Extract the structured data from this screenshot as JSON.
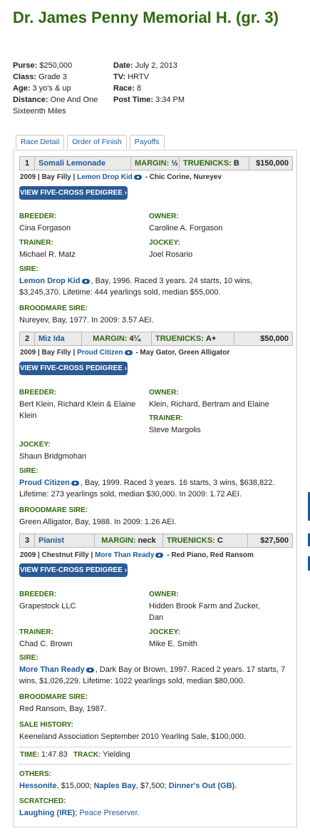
{
  "race": {
    "title": "Dr. James Penny Memorial H. (gr. 3)",
    "purse_label": "Purse:",
    "purse": "$250,000",
    "class_label": "Class:",
    "class": "Grade 3",
    "age_label": "Age:",
    "age": "3 yo's & up",
    "distance_label": "Distance:",
    "distance": "One And One Sixteenth Miles",
    "date_label": "Date:",
    "date": "July 2, 2013",
    "tv_label": "TV:",
    "tv": "HRTV",
    "race_label": "Race:",
    "race": "8",
    "post_label": "Post Time:",
    "post": "3:34 PM"
  },
  "tabs": [
    "Race Detail",
    "Order of Finish",
    "Payoffs"
  ],
  "labels": {
    "margin": "MARGIN:",
    "truenicks": "TRUENICKS:",
    "pedigree_button": "VIEW FIVE-CROSS PEDIGREE ›",
    "breeder": "BREEDER:",
    "owner": "OWNER:",
    "trainer": "TRAINER:",
    "jockey": "JOCKEY:",
    "sire": "SIRE:",
    "broodmare_sire": "BROODMARE SIRE:",
    "sale_history": "SALE HISTORY:",
    "time": "TIME:",
    "track": "TRACK:",
    "others": "OTHERS:",
    "scratched": "SCRATCHED:"
  },
  "horses": [
    {
      "pos": "1",
      "name": "Somali Lemonade",
      "margin": "½",
      "truenicks": "B",
      "earnings": "$150,000",
      "info_prefix": "2009 | Bay Filly |",
      "info_sire": "Lemon Drop Kid",
      "info_suffix": "- Chic Corine, Nureyev",
      "breeder": "Cina Forgason",
      "owner": "Caroline A. Forgason",
      "trainer": "Michael R. Matz",
      "jockey": "Joel Rosario",
      "sire_name": "Lemon Drop Kid",
      "sire_text": ", Bay, 1996. Raced 3 years. 24 starts, 10 wins, $3,245,370. Lifetime: 444 yearlings sold, median $55,000.",
      "broodmare_sire": "Nureyev, Bay, 1977. In 2009: 3.57 AEI."
    },
    {
      "pos": "2",
      "name": "Miz Ida",
      "margin": "4¼",
      "truenicks": "A+",
      "earnings": "$50,000",
      "info_prefix": "2009 | Bay Filly |",
      "info_sire": "Proud Citizen",
      "info_suffix": "- May Gator, Green Alligator",
      "breeder": "Bert Klein, Richard Klein & Elaine Klein",
      "owner": "Klein, Richard, Bertram and Elaine",
      "trainer": "Steve Margolis",
      "jockey": "Shaun Bridgmohan",
      "sire_name": "Proud Citizen",
      "sire_text": ", Bay, 1999. Raced 3 years. 16 starts, 3 wins, $638,822. Lifetime: 273 yearlings sold, median $30,000. In 2009: 1.72 AEI.",
      "broodmare_sire": "Green Alligator, Bay, 1988. In 2009: 1.26 AEI."
    },
    {
      "pos": "3",
      "name": "Pianist",
      "margin": "neck",
      "truenicks": "C",
      "earnings": "$27,500",
      "info_prefix": "2009 | Chestnut Filly |",
      "info_sire": "More Than Ready",
      "info_suffix": "- Red Piano, Red Ransom",
      "breeder": "Grapestock LLC",
      "owner": "Hidden Brook Farm and Zucker, Dan",
      "trainer": "Chad C. Brown",
      "jockey": "Mike E. Smith",
      "sire_name": "More Than Ready",
      "sire_text": ", Dark Bay or Brown, 1997. Raced 2 years. 17 starts, 7 wins, $1,026,229. Lifetime: 1022 yearlings sold, median $80,000.",
      "broodmare_sire": "Red Ransom, Bay, 1987.",
      "sale_history": "Keeneland Association September 2010 Yearling Sale, $100,000."
    }
  ],
  "result": {
    "time": "1:47.83",
    "track": "Yielding",
    "others": [
      {
        "name": "Hessonite",
        "amount": ", $15,000; "
      },
      {
        "name": "Naples Bay",
        "amount": ", $7,500; "
      },
      {
        "name": "Dinner's Out (GB)",
        "amount": "."
      }
    ],
    "scratched": [
      {
        "name": "Laughing (IRE)",
        "sep": "; "
      },
      {
        "name": "Peace Preserver",
        "sep": "."
      }
    ]
  },
  "colors": {
    "green": "#2e6a0f",
    "blue": "#1e5a9a",
    "button": "#2b5a95"
  }
}
